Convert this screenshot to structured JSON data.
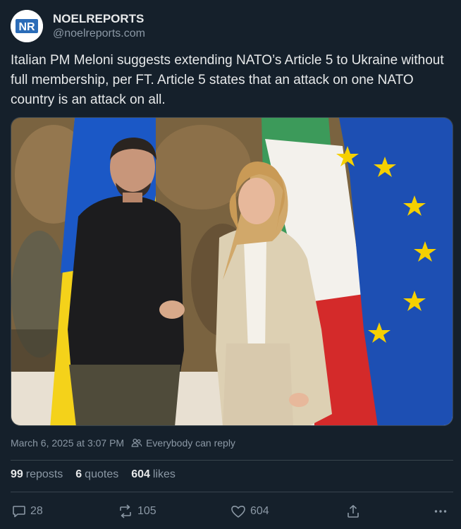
{
  "account": {
    "display_name": "NOELREPORTS",
    "handle": "@noelreports.com",
    "avatar_letters": "NR",
    "avatar_color": "#2b6cb8"
  },
  "post": {
    "text": "Italian PM Meloni suggests extending NATO’s Article 5 to Ukraine without full membership, per FT. Article 5 states that an attack on one NATO country is an attack on all.",
    "image_icon": "photo"
  },
  "meta": {
    "timestamp": "March 6, 2025 at 3:07 PM",
    "reply_setting": "Everybody can reply",
    "reply_icon": "people-icon"
  },
  "stats": {
    "reposts_count": "99",
    "reposts_label": "reposts",
    "quotes_count": "6",
    "quotes_label": "quotes",
    "likes_count": "604",
    "likes_label": "likes"
  },
  "actions": {
    "reply_count": "28",
    "repost_count": "105",
    "like_count": "604",
    "reply_icon": "comment-icon",
    "repost_icon": "repost-icon",
    "like_icon": "heart-icon",
    "share_icon": "share-icon",
    "more_icon": "more-icon"
  },
  "colors": {
    "background": "#15202b",
    "text": "#e7e9ea",
    "secondary_text": "#8b98a5",
    "divider": "#38444d"
  }
}
